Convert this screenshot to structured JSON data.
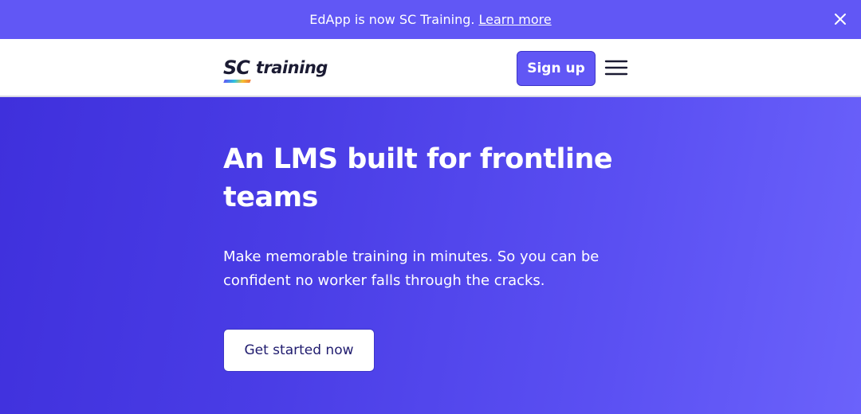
{
  "announcement": {
    "message": "EdApp is now SC Training.",
    "link_label": "Learn more",
    "close_icon": "close-icon"
  },
  "nav": {
    "logo_mark": "SC",
    "logo_word": "training",
    "signup_label": "Sign up",
    "menu_icon": "hamburger-menu-icon"
  },
  "hero": {
    "title": "An LMS built for frontline teams",
    "subtitle": "Make memorable training in minutes. So you can be confident no worker falls through the cracks.",
    "cta_label": "Get started now"
  },
  "colors": {
    "brand": "#6157f5",
    "hero_gradient_start": "#3f30dc",
    "hero_gradient_end": "#6b62fb",
    "text_dark": "#1b1b33",
    "cta_text": "#1f1b6e"
  }
}
